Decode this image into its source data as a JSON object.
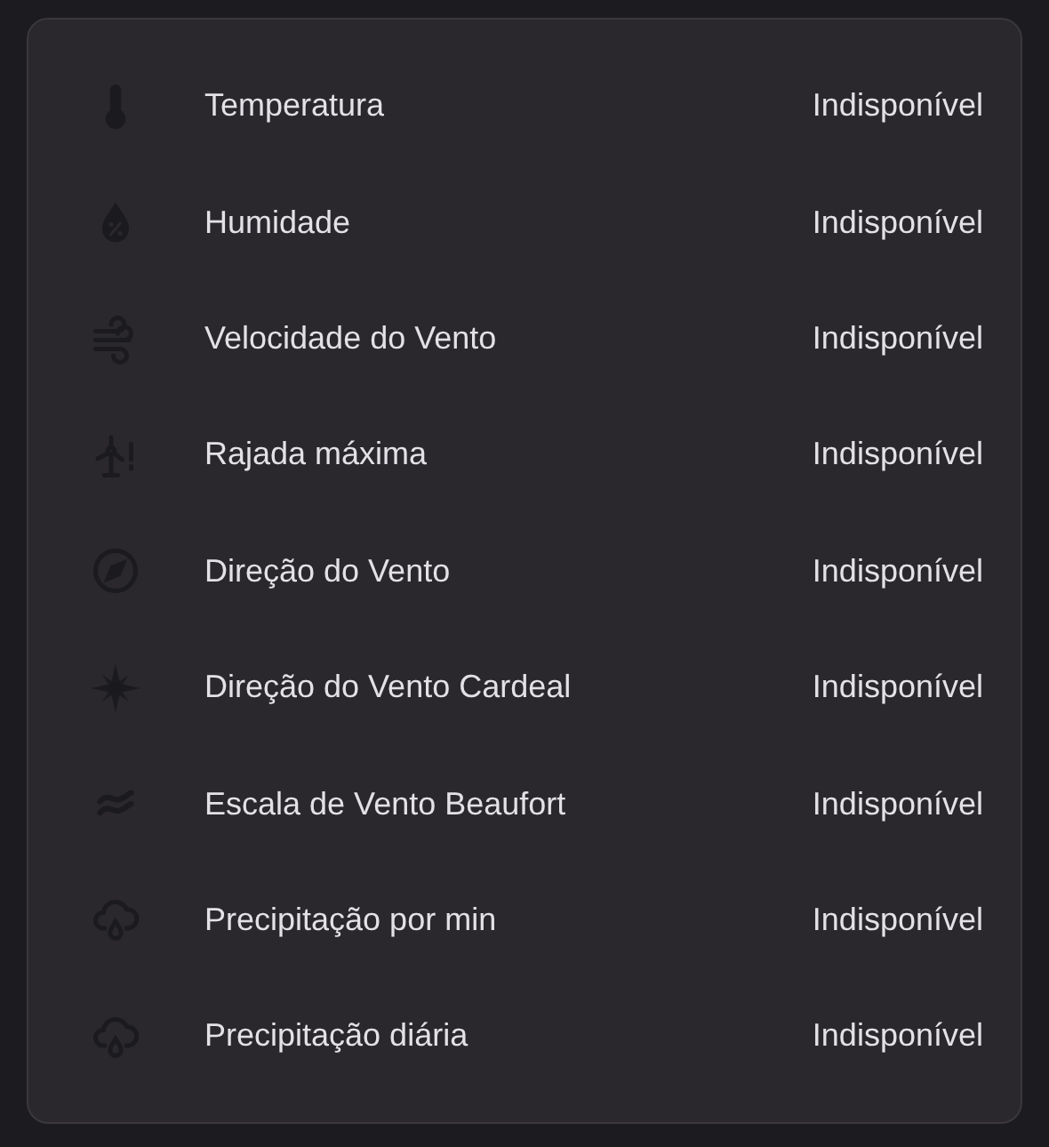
{
  "sensors": [
    {
      "name": "Temperatura",
      "state": "Indisponível"
    },
    {
      "name": "Humidade",
      "state": "Indisponível"
    },
    {
      "name": "Velocidade do Vento",
      "state": "Indisponível"
    },
    {
      "name": "Rajada máxima",
      "state": "Indisponível"
    },
    {
      "name": "Direção do Vento",
      "state": "Indisponível"
    },
    {
      "name": "Direção do Vento Cardeal",
      "state": "Indisponível"
    },
    {
      "name": "Escala de Vento Beaufort",
      "state": "Indisponível"
    },
    {
      "name": "Precipitação por min",
      "state": "Indisponível"
    },
    {
      "name": "Precipitação diária",
      "state": "Indisponível"
    }
  ]
}
